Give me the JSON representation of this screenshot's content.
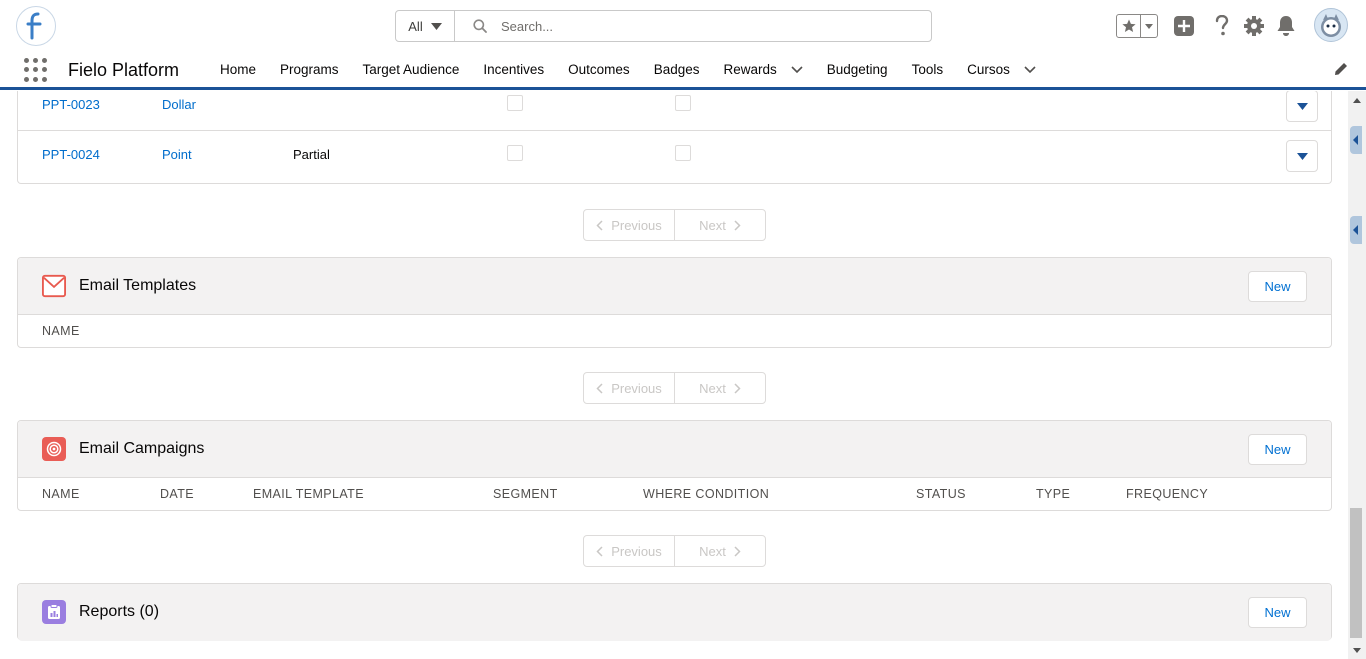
{
  "header": {
    "search": {
      "scope": "All",
      "placeholder": "Search..."
    }
  },
  "nav": {
    "app_name": "Fielo Platform",
    "items": [
      {
        "label": "Home"
      },
      {
        "label": "Programs"
      },
      {
        "label": "Target Audience"
      },
      {
        "label": "Incentives"
      },
      {
        "label": "Outcomes"
      },
      {
        "label": "Badges"
      },
      {
        "label": "Rewards"
      },
      {
        "label": "Budgeting"
      },
      {
        "label": "Tools"
      },
      {
        "label": "Cursos"
      }
    ]
  },
  "table_rows": [
    {
      "id": "PPT-0023",
      "type": "Dollar",
      "mode": ""
    },
    {
      "id": "PPT-0024",
      "type": "Point",
      "mode": "Partial"
    }
  ],
  "pager": {
    "previous_label": "Previous",
    "next_label": "Next"
  },
  "email_templates": {
    "title": "Email Templates",
    "new_label": "New",
    "columns": [
      "NAME"
    ]
  },
  "email_campaigns": {
    "title": "Email Campaigns",
    "new_label": "New",
    "columns": [
      "NAME",
      "DATE",
      "EMAIL TEMPLATE",
      "SEGMENT",
      "WHERE CONDITION",
      "STATUS",
      "TYPE",
      "FREQUENCY"
    ]
  },
  "reports": {
    "title": "Reports (0)",
    "new_label": "New"
  },
  "colors": {
    "brand_blue": "#1b5297",
    "link_blue": "#006dcc",
    "email_icon": "#e85a4f",
    "campaign_icon": "#e95d56",
    "report_icon": "#9a7ee0"
  },
  "icons": [
    "fielo-logo-icon",
    "chevron-down-icon",
    "search-icon",
    "star-icon",
    "add-icon",
    "help-icon",
    "gear-icon",
    "bell-icon",
    "avatar-icon",
    "app-launcher-icon",
    "pencil-icon",
    "envelope-icon",
    "target-icon",
    "report-icon",
    "chevron-left-icon",
    "chevron-right-icon"
  ]
}
